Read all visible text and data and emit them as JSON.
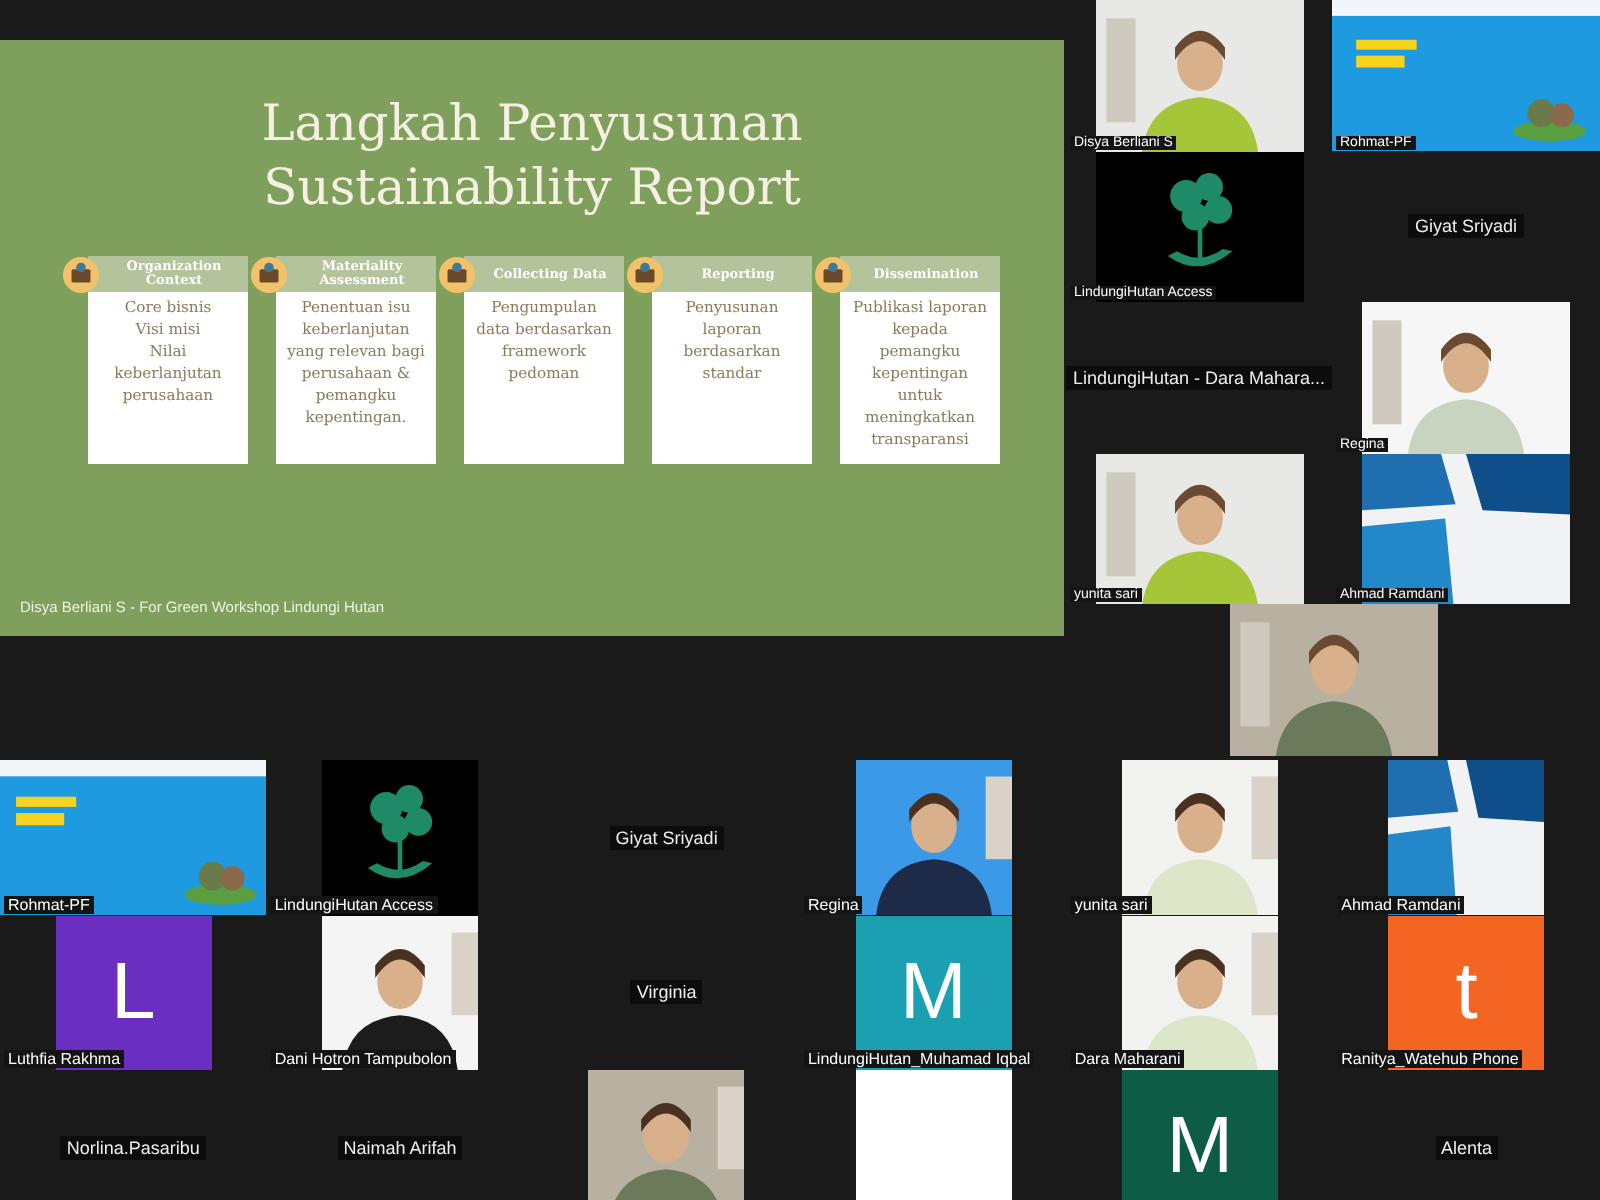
{
  "slide": {
    "title": "Langkah Penyusunan Sustainability Report",
    "footer": "Disya Berliani S - For Green Workshop Lindungi Hutan",
    "steps": [
      {
        "heading": "Organization Context",
        "body": "Core bisnis\nVisi misi\nNilai\nkeberlanjutan\nperusahaan"
      },
      {
        "heading": "Materiality Assessment",
        "body": "Penentuan isu\nkeberlanjutan\nyang relevan bagi\nperusahaan &\npemangku\nkepentingan."
      },
      {
        "heading": "Collecting Data",
        "body": "Pengumpulan\ndata berdasarkan\nframework\npedoman"
      },
      {
        "heading": "Reporting",
        "body": "Penyusunan\nlaporan\nberdasarkan\nstandar"
      },
      {
        "heading": "Dissemination",
        "body": "Publikasi laporan\nkepada\npemangku\nkepentingan\nuntuk\nmeningkatkan\ntransparansi"
      }
    ]
  },
  "side_tiles": [
    {
      "kind": "camera",
      "name": "Disya Berliani S"
    },
    {
      "kind": "screen",
      "name": "Rohmat-PF"
    },
    {
      "kind": "logo",
      "name": "LindungiHutan Access"
    },
    {
      "kind": "name",
      "name": "Giyat Sriyadi"
    },
    {
      "kind": "name",
      "name": "LindungiHutan - Dara Mahara..."
    },
    {
      "kind": "camera",
      "name": "Regina"
    },
    {
      "kind": "camera",
      "name": "yunita sari"
    },
    {
      "kind": "brand",
      "name": "Ahmad Ramdani"
    },
    {
      "kind": "camera"
    }
  ],
  "grid_tiles": [
    {
      "kind": "screen",
      "name": "Rohmat-PF"
    },
    {
      "kind": "logo",
      "name": "LindungiHutan Access"
    },
    {
      "kind": "name",
      "name": "Giyat Sriyadi"
    },
    {
      "kind": "camera",
      "name": "Regina"
    },
    {
      "kind": "camera",
      "name": "yunita sari"
    },
    {
      "kind": "brand",
      "name": "Ahmad Ramdani"
    },
    {
      "kind": "avatar",
      "letter": "L",
      "color": "#6a2fc0",
      "name": "Luthfia Rakhma"
    },
    {
      "kind": "camera",
      "name": "Dani Hotron Tampubolon"
    },
    {
      "kind": "name",
      "name": "Virginia"
    },
    {
      "kind": "avatar",
      "letter": "M",
      "color": "#1aa0b0",
      "name": "LindungiHutan_Muhamad Iqbal"
    },
    {
      "kind": "camera",
      "name": "Dara Maharani"
    },
    {
      "kind": "avatar",
      "letter": "t",
      "color": "#f26522",
      "name": "Ranitya_Watehub Phone"
    },
    {
      "kind": "name",
      "name": "Norlina.Pasaribu"
    },
    {
      "kind": "name",
      "name": "Naimah Arifah"
    },
    {
      "kind": "camera"
    },
    {
      "kind": "blank"
    },
    {
      "kind": "avatar",
      "letter": "M",
      "color": "#0e5c45"
    },
    {
      "kind": "name",
      "name": "Alenta"
    }
  ]
}
